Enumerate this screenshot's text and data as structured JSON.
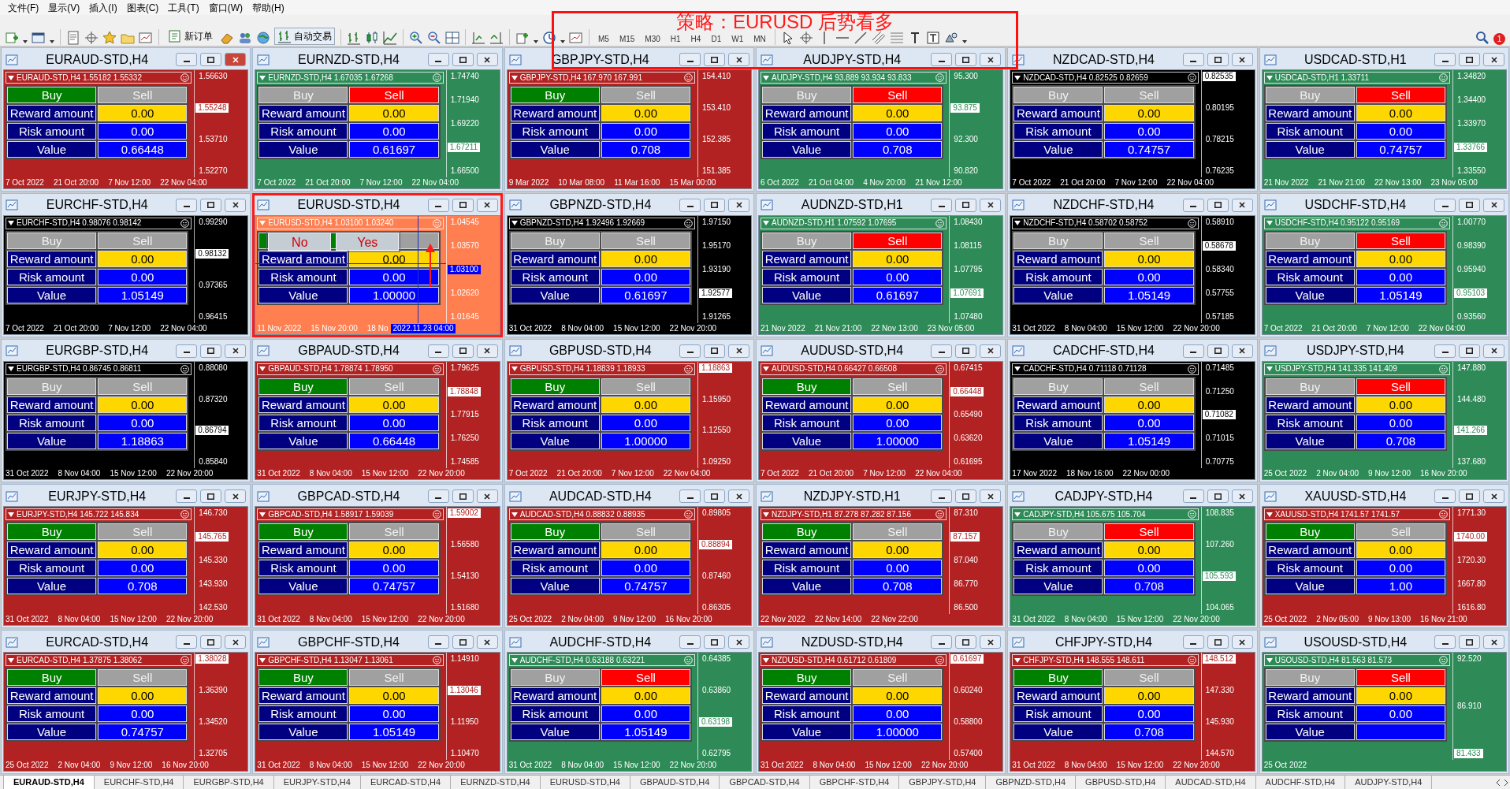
{
  "menu": [
    "文件(F)",
    "显示(V)",
    "插入(I)",
    "图表(C)",
    "工具(T)",
    "窗口(W)",
    "帮助(H)"
  ],
  "toolbar": {
    "new_order": "新订单",
    "auto_trading": "自动交易",
    "timeframes": [
      "M5",
      "M15",
      "M30",
      "H1",
      "H4",
      "D1",
      "W1",
      "MN"
    ],
    "notifications": "1"
  },
  "banner": {
    "text": "策略：EURUSD 后势看多"
  },
  "windows": [
    {
      "title": "EURAUD-STD,H4",
      "active": true,
      "color": "#b22222",
      "header": "EURAUD-STD,H4  1.55182 1.55332",
      "buy": {
        "label": "Buy",
        "selected": true
      },
      "sell": {
        "label": "Sell",
        "selected": false
      },
      "fields": [
        {
          "kind": "reward",
          "label": "Reward amount",
          "value": "0.00"
        },
        {
          "kind": "risk",
          "label": "Risk amount",
          "value": "0.00"
        },
        {
          "kind": "value",
          "label": "Value",
          "value": "0.66448"
        }
      ],
      "axis": [
        {
          "kind": "tick",
          "text": "1.56630"
        },
        {
          "kind": "tag",
          "text": "1.55248"
        },
        {
          "kind": "tick",
          "text": "1.53710"
        },
        {
          "kind": "tick",
          "text": "1.52270"
        }
      ],
      "dates": [
        "7 Oct 2022",
        "21 Oct 20:00",
        "7 Nov 12:00",
        "22 Nov 04:00"
      ]
    },
    {
      "title": "EURNZD-STD,H4",
      "active": false,
      "color": "#2e8b57",
      "header": "EURNZD-STD,H4  1.67035 1.67268",
      "buy": {
        "label": "Buy",
        "selected": false
      },
      "sell": {
        "label": "Sell",
        "selected": true
      },
      "fields": [
        {
          "kind": "reward",
          "label": "Reward amount",
          "value": "0.00"
        },
        {
          "kind": "risk",
          "label": "Risk amount",
          "value": "0.00"
        },
        {
          "kind": "value",
          "label": "Value",
          "value": "0.61697"
        }
      ],
      "axis": [
        {
          "kind": "tick",
          "text": "1.74740"
        },
        {
          "kind": "tick",
          "text": "1.71940"
        },
        {
          "kind": "tick",
          "text": "1.69220"
        },
        {
          "kind": "tag",
          "text": "1.67211"
        },
        {
          "kind": "tick",
          "text": "1.66500"
        }
      ],
      "dates": [
        "7 Oct 2022",
        "21 Oct 20:00",
        "7 Nov 12:00",
        "22 Nov 04:00"
      ]
    },
    {
      "title": "GBPJPY-STD,H4",
      "active": false,
      "color": "#b22222",
      "header": "GBPJPY-STD,H4  167.970 167.991",
      "buy": {
        "label": "Buy",
        "selected": true
      },
      "sell": {
        "label": "Sell",
        "selected": false
      },
      "fields": [
        {
          "kind": "reward",
          "label": "Reward amount",
          "value": "0.00"
        },
        {
          "kind": "risk",
          "label": "Risk amount",
          "value": "0.00"
        },
        {
          "kind": "value",
          "label": "Value",
          "value": "0.708"
        }
      ],
      "axis": [
        {
          "kind": "tick",
          "text": "154.410"
        },
        {
          "kind": "tick",
          "text": "153.410"
        },
        {
          "kind": "tick",
          "text": "152.385"
        },
        {
          "kind": "tick",
          "text": "151.385"
        }
      ],
      "dates": [
        "9 Mar 2022",
        "10 Mar 08:00",
        "11 Mar 16:00",
        "15 Mar 00:00"
      ]
    },
    {
      "title": "AUDJPY-STD,H4",
      "active": false,
      "color": "#2e8b57",
      "header": "AUDJPY-STD,H4  93.889 93.934 93.833",
      "buy": {
        "label": "Buy",
        "selected": false
      },
      "sell": {
        "label": "Sell",
        "selected": true
      },
      "fields": [
        {
          "kind": "reward",
          "label": "Reward amount",
          "value": "0.00"
        },
        {
          "kind": "risk",
          "label": "Risk amount",
          "value": "0.00"
        },
        {
          "kind": "value",
          "label": "Value",
          "value": "0.708"
        }
      ],
      "axis": [
        {
          "kind": "tick",
          "text": "95.300"
        },
        {
          "kind": "tag",
          "text": "93.875"
        },
        {
          "kind": "tick",
          "text": "92.300"
        },
        {
          "kind": "tick",
          "text": "90.820"
        }
      ],
      "dates": [
        "6 Oct 2022",
        "21 Oct 04:00",
        "4 Nov 20:00",
        "21 Nov 12:00"
      ]
    },
    {
      "title": "NZDCAD-STD,H4",
      "active": false,
      "color": "#000000",
      "header": "NZDCAD-STD,H4  0.82525 0.82659",
      "buy": {
        "label": "Buy",
        "selected": false
      },
      "sell": {
        "label": "Sell",
        "selected": false
      },
      "fields": [
        {
          "kind": "reward",
          "label": "Reward amount",
          "value": "0.00"
        },
        {
          "kind": "risk",
          "label": "Risk amount",
          "value": "0.00"
        },
        {
          "kind": "value",
          "label": "Value",
          "value": "0.74757"
        }
      ],
      "axis": [
        {
          "kind": "tag",
          "text": "0.82535"
        },
        {
          "kind": "tick",
          "text": "0.80195"
        },
        {
          "kind": "tick",
          "text": "0.78215"
        },
        {
          "kind": "tick",
          "text": "0.76235"
        }
      ],
      "dates": [
        "7 Oct 2022",
        "21 Oct 20:00",
        "7 Nov 12:00",
        "22 Nov 04:00"
      ]
    },
    {
      "title": "USDCAD-STD,H1",
      "active": false,
      "color": "#2e8b57",
      "header": "USDCAD-STD,H1  1.33711",
      "buy": {
        "label": "Buy",
        "selected": false
      },
      "sell": {
        "label": "Sell",
        "selected": true
      },
      "fields": [
        {
          "kind": "reward",
          "label": "Reward amount",
          "value": "0.00"
        },
        {
          "kind": "risk",
          "label": "Risk amount",
          "value": "0.00"
        },
        {
          "kind": "value",
          "label": "Value",
          "value": "0.74757"
        }
      ],
      "axis": [
        {
          "kind": "tick",
          "text": "1.34820"
        },
        {
          "kind": "tick",
          "text": "1.34400"
        },
        {
          "kind": "tick",
          "text": "1.33970"
        },
        {
          "kind": "tag",
          "text": "1.33766"
        },
        {
          "kind": "tick",
          "text": "1.33550"
        }
      ],
      "dates": [
        "21 Nov 2022",
        "21 Nov 21:00",
        "22 Nov 13:00",
        "23 Nov 05:00"
      ]
    },
    {
      "title": "EURCHF-STD,H4",
      "active": false,
      "color": "#000000",
      "header": "EURCHF-STD,H4  0.98076 0.98142",
      "buy": {
        "label": "Buy",
        "selected": false
      },
      "sell": {
        "label": "Sell",
        "selected": false
      },
      "fields": [
        {
          "kind": "reward",
          "label": "Reward amount",
          "value": "0.00"
        },
        {
          "kind": "risk",
          "label": "Risk amount",
          "value": "0.00"
        },
        {
          "kind": "value",
          "label": "Value",
          "value": "1.05149"
        }
      ],
      "axis": [
        {
          "kind": "tick",
          "text": "0.99290"
        },
        {
          "kind": "tag",
          "text": "0.98132"
        },
        {
          "kind": "tick",
          "text": "0.97365"
        },
        {
          "kind": "tick",
          "text": "0.96415"
        }
      ],
      "dates": [
        "7 Oct 2022",
        "21 Oct 20:00",
        "7 Nov 12:00",
        "22 Nov 04:00"
      ]
    },
    {
      "title": "EURUSD-STD,H4",
      "active": false,
      "highlighted": true,
      "crosshair": true,
      "color": "#ff7f50",
      "header": "EURUSD-STD,H4  1.03100 1.03240",
      "buy": {
        "selected": true
      },
      "sell": {
        "selected": false
      },
      "dialog": [
        "No",
        "Yes"
      ],
      "fields": [
        {
          "kind": "reward",
          "label": "Reward amount",
          "value": "0.00"
        },
        {
          "kind": "risk",
          "label": "Risk amount",
          "value": "0.00"
        },
        {
          "kind": "value",
          "label": "Value",
          "value": "1.00000"
        }
      ],
      "axis": [
        {
          "kind": "tick",
          "text": "1.04545"
        },
        {
          "kind": "tick",
          "text": "1.03570"
        },
        {
          "kind": "cursor",
          "text": "1.03100"
        },
        {
          "kind": "tick",
          "text": "1.02620"
        },
        {
          "kind": "tick",
          "text": "1.01645"
        }
      ],
      "dates": [
        "11 Nov 2022",
        "15 Nov 20:00",
        "18 No"
      ],
      "date_cursor": "2022.11.23 04:00"
    },
    {
      "title": "GBPNZD-STD,H4",
      "active": false,
      "color": "#000000",
      "header": "GBPNZD-STD,H4  1.92496 1.92669",
      "buy": {
        "label": "Buy",
        "selected": false
      },
      "sell": {
        "label": "Sell",
        "selected": false
      },
      "fields": [
        {
          "kind": "reward",
          "label": "Reward amount",
          "value": "0.00"
        },
        {
          "kind": "risk",
          "label": "Risk amount",
          "value": "0.00"
        },
        {
          "kind": "value",
          "label": "Value",
          "value": "0.61697"
        }
      ],
      "axis": [
        {
          "kind": "tick",
          "text": "1.97150"
        },
        {
          "kind": "tick",
          "text": "1.95170"
        },
        {
          "kind": "tick",
          "text": "1.93190"
        },
        {
          "kind": "tag",
          "text": "1.92577"
        },
        {
          "kind": "tick",
          "text": "1.91265"
        }
      ],
      "dates": [
        "31 Oct 2022",
        "8 Nov 04:00",
        "15 Nov 12:00",
        "22 Nov 20:00"
      ]
    },
    {
      "title": "AUDNZD-STD,H1",
      "active": false,
      "color": "#2e8b57",
      "header": "AUDNZD-STD,H1  1.07592 1.07695",
      "buy": {
        "label": "Buy",
        "selected": false
      },
      "sell": {
        "label": "Sell",
        "selected": true
      },
      "fields": [
        {
          "kind": "reward",
          "label": "Reward amount",
          "value": "0.00"
        },
        {
          "kind": "risk",
          "label": "Risk amount",
          "value": "0.00"
        },
        {
          "kind": "value",
          "label": "Value",
          "value": "0.61697"
        }
      ],
      "axis": [
        {
          "kind": "tick",
          "text": "1.08430"
        },
        {
          "kind": "tick",
          "text": "1.08115"
        },
        {
          "kind": "tick",
          "text": "1.07795"
        },
        {
          "kind": "tag",
          "text": "1.07691"
        },
        {
          "kind": "tick",
          "text": "1.07480"
        }
      ],
      "dates": [
        "21 Nov 2022",
        "21 Nov 21:00",
        "22 Nov 13:00",
        "23 Nov 05:00"
      ]
    },
    {
      "title": "NZDCHF-STD,H4",
      "active": false,
      "color": "#000000",
      "header": "NZDCHF-STD,H4  0.58702 0.58752",
      "buy": {
        "label": "Buy",
        "selected": false
      },
      "sell": {
        "label": "Sell",
        "selected": false
      },
      "fields": [
        {
          "kind": "reward",
          "label": "Reward amount",
          "value": "0.00"
        },
        {
          "kind": "risk",
          "label": "Risk amount",
          "value": "0.00"
        },
        {
          "kind": "value",
          "label": "Value",
          "value": "1.05149"
        }
      ],
      "axis": [
        {
          "kind": "tick",
          "text": "0.58910"
        },
        {
          "kind": "tag",
          "text": "0.58678"
        },
        {
          "kind": "tick",
          "text": "0.58340"
        },
        {
          "kind": "tick",
          "text": "0.57755"
        },
        {
          "kind": "tick",
          "text": "0.57185"
        }
      ],
      "dates": [
        "31 Oct 2022",
        "8 Nov 04:00",
        "15 Nov 12:00",
        "22 Nov 20:00"
      ]
    },
    {
      "title": "USDCHF-STD,H4",
      "active": false,
      "color": "#2e8b57",
      "header": "USDCHF-STD,H4  0.95122 0.95169",
      "buy": {
        "label": "Buy",
        "selected": false
      },
      "sell": {
        "label": "Sell",
        "selected": true
      },
      "fields": [
        {
          "kind": "reward",
          "label": "Reward amount",
          "value": "0.00"
        },
        {
          "kind": "risk",
          "label": "Risk amount",
          "value": "0.00"
        },
        {
          "kind": "value",
          "label": "Value",
          "value": "1.05149"
        }
      ],
      "axis": [
        {
          "kind": "tick",
          "text": "1.00770"
        },
        {
          "kind": "tick",
          "text": "0.98390"
        },
        {
          "kind": "tick",
          "text": "0.95940"
        },
        {
          "kind": "tag",
          "text": "0.95103"
        },
        {
          "kind": "tick",
          "text": "0.93560"
        }
      ],
      "dates": [
        "7 Oct 2022",
        "21 Oct 20:00",
        "7 Nov 12:00",
        "22 Nov 04:00"
      ]
    },
    {
      "title": "EURGBP-STD,H4",
      "active": false,
      "color": "#000000",
      "header": "EURGBP-STD,H4  0.86745 0.86811",
      "buy": {
        "label": "Buy",
        "selected": false
      },
      "sell": {
        "label": "Sell",
        "selected": false
      },
      "fields": [
        {
          "kind": "reward",
          "label": "Reward amount",
          "value": "0.00"
        },
        {
          "kind": "risk",
          "label": "Risk amount",
          "value": "0.00"
        },
        {
          "kind": "value",
          "label": "Value",
          "value": "1.18863"
        }
      ],
      "axis": [
        {
          "kind": "tick",
          "text": "0.88080"
        },
        {
          "kind": "tick",
          "text": "0.87320"
        },
        {
          "kind": "tag",
          "text": "0.86794"
        },
        {
          "kind": "tick",
          "text": "0.85840"
        }
      ],
      "dates": [
        "31 Oct 2022",
        "8 Nov 04:00",
        "15 Nov 12:00",
        "22 Nov 20:00"
      ]
    },
    {
      "title": "GBPAUD-STD,H4",
      "active": false,
      "color": "#b22222",
      "header": "GBPAUD-STD,H4  1.78874 1.78950",
      "buy": {
        "label": "Buy",
        "selected": true
      },
      "sell": {
        "label": "Sell",
        "selected": false
      },
      "fields": [
        {
          "kind": "reward",
          "label": "Reward amount",
          "value": "0.00"
        },
        {
          "kind": "risk",
          "label": "Risk amount",
          "value": "0.00"
        },
        {
          "kind": "value",
          "label": "Value",
          "value": "0.66448"
        }
      ],
      "axis": [
        {
          "kind": "tick",
          "text": "1.79625"
        },
        {
          "kind": "tag",
          "text": "1.78848"
        },
        {
          "kind": "tick",
          "text": "1.77915"
        },
        {
          "kind": "tick",
          "text": "1.76250"
        },
        {
          "kind": "tick",
          "text": "1.74585"
        }
      ],
      "dates": [
        "31 Oct 2022",
        "8 Nov 04:00",
        "15 Nov 12:00",
        "22 Nov 20:00"
      ]
    },
    {
      "title": "GBPUSD-STD,H4",
      "active": false,
      "color": "#b22222",
      "header": "GBPUSD-STD,H4  1.18839 1.18933",
      "buy": {
        "label": "Buy",
        "selected": true
      },
      "sell": {
        "label": "Sell",
        "selected": false
      },
      "fields": [
        {
          "kind": "reward",
          "label": "Reward amount",
          "value": "0.00"
        },
        {
          "kind": "risk",
          "label": "Risk amount",
          "value": "0.00"
        },
        {
          "kind": "value",
          "label": "Value",
          "value": "1.00000"
        }
      ],
      "axis": [
        {
          "kind": "tag",
          "text": "1.18863"
        },
        {
          "kind": "tick",
          "text": "1.15950"
        },
        {
          "kind": "tick",
          "text": "1.12550"
        },
        {
          "kind": "tick",
          "text": "1.09250"
        }
      ],
      "dates": [
        "7 Oct 2022",
        "21 Oct 20:00",
        "7 Nov 12:00",
        "22 Nov 04:00"
      ]
    },
    {
      "title": "AUDUSD-STD,H4",
      "active": false,
      "color": "#b22222",
      "header": "AUDUSD-STD,H4  0.66427 0.66508",
      "buy": {
        "label": "Buy",
        "selected": true
      },
      "sell": {
        "label": "Sell",
        "selected": false
      },
      "fields": [
        {
          "kind": "reward",
          "label": "Reward amount",
          "value": "0.00"
        },
        {
          "kind": "risk",
          "label": "Risk amount",
          "value": "0.00"
        },
        {
          "kind": "value",
          "label": "Value",
          "value": "1.00000"
        }
      ],
      "axis": [
        {
          "kind": "tick",
          "text": "0.67415"
        },
        {
          "kind": "tag",
          "text": "0.66448"
        },
        {
          "kind": "tick",
          "text": "0.65490"
        },
        {
          "kind": "tick",
          "text": "0.63620"
        },
        {
          "kind": "tick",
          "text": "0.61695"
        }
      ],
      "dates": [
        "7 Oct 2022",
        "21 Oct 20:00",
        "7 Nov 12:00",
        "22 Nov 04:00"
      ]
    },
    {
      "title": "CADCHF-STD,H4",
      "active": false,
      "color": "#000000",
      "header": "CADCHF-STD,H4  0.71118 0.71128",
      "buy": {
        "label": "Buy",
        "selected": false
      },
      "sell": {
        "label": "Sell",
        "selected": false
      },
      "fields": [
        {
          "kind": "reward",
          "label": "Reward amount",
          "value": "0.00"
        },
        {
          "kind": "risk",
          "label": "Risk amount",
          "value": "0.00"
        },
        {
          "kind": "value",
          "label": "Value",
          "value": "1.05149"
        }
      ],
      "axis": [
        {
          "kind": "tick",
          "text": "0.71485"
        },
        {
          "kind": "tick",
          "text": "0.71250"
        },
        {
          "kind": "tag",
          "text": "0.71082"
        },
        {
          "kind": "tick",
          "text": "0.71015"
        },
        {
          "kind": "tick",
          "text": "0.70775"
        }
      ],
      "dates": [
        "17 Nov 2022",
        "18 Nov 16:00",
        "22 Nov 00:00"
      ]
    },
    {
      "title": "USDJPY-STD,H4",
      "active": false,
      "color": "#2e8b57",
      "header": "USDJPY-STD,H4  141.335 141.409",
      "buy": {
        "label": "Buy",
        "selected": false
      },
      "sell": {
        "label": "Sell",
        "selected": true
      },
      "fields": [
        {
          "kind": "reward",
          "label": "Reward amount",
          "value": "0.00"
        },
        {
          "kind": "risk",
          "label": "Risk amount",
          "value": "0.00"
        },
        {
          "kind": "value",
          "label": "Value",
          "value": "0.708"
        }
      ],
      "axis": [
        {
          "kind": "tick",
          "text": "147.880"
        },
        {
          "kind": "tick",
          "text": "144.480"
        },
        {
          "kind": "tag",
          "text": "141.266"
        },
        {
          "kind": "tick",
          "text": "137.680"
        }
      ],
      "dates": [
        "25 Oct 2022",
        "2 Nov 04:00",
        "9 Nov 12:00",
        "16 Nov 20:00"
      ]
    },
    {
      "title": "EURJPY-STD,H4",
      "active": false,
      "color": "#b22222",
      "header": "EURJPY-STD,H4  145.722 145.834",
      "buy": {
        "label": "Buy",
        "selected": true
      },
      "sell": {
        "label": "Sell",
        "selected": false
      },
      "fields": [
        {
          "kind": "reward",
          "label": "Reward amount",
          "value": "0.00"
        },
        {
          "kind": "risk",
          "label": "Risk amount",
          "value": "0.00"
        },
        {
          "kind": "value",
          "label": "Value",
          "value": "0.708"
        }
      ],
      "axis": [
        {
          "kind": "tick",
          "text": "146.730"
        },
        {
          "kind": "tag",
          "text": "145.765"
        },
        {
          "kind": "tick",
          "text": "145.330"
        },
        {
          "kind": "tick",
          "text": "143.930"
        },
        {
          "kind": "tick",
          "text": "142.530"
        }
      ],
      "dates": [
        "31 Oct 2022",
        "8 Nov 04:00",
        "15 Nov 12:00",
        "22 Nov 20:00"
      ]
    },
    {
      "title": "GBPCAD-STD,H4",
      "active": false,
      "color": "#b22222",
      "header": "GBPCAD-STD,H4  1.58917 1.59039",
      "buy": {
        "label": "Buy",
        "selected": true
      },
      "sell": {
        "label": "Sell",
        "selected": false
      },
      "fields": [
        {
          "kind": "reward",
          "label": "Reward amount",
          "value": "0.00"
        },
        {
          "kind": "risk",
          "label": "Risk amount",
          "value": "0.00"
        },
        {
          "kind": "value",
          "label": "Value",
          "value": "0.74757"
        }
      ],
      "axis": [
        {
          "kind": "tag",
          "text": "1.59002"
        },
        {
          "kind": "tick",
          "text": "1.56580"
        },
        {
          "kind": "tick",
          "text": "1.54130"
        },
        {
          "kind": "tick",
          "text": "1.51680"
        }
      ],
      "dates": [
        "31 Oct 2022",
        "8 Nov 04:00",
        "15 Nov 12:00",
        "22 Nov 20:00"
      ]
    },
    {
      "title": "AUDCAD-STD,H4",
      "active": false,
      "color": "#b22222",
      "header": "AUDCAD-STD,H4  0.88832 0.88935",
      "buy": {
        "label": "Buy",
        "selected": true
      },
      "sell": {
        "label": "Sell",
        "selected": false
      },
      "fields": [
        {
          "kind": "reward",
          "label": "Reward amount",
          "value": "0.00"
        },
        {
          "kind": "risk",
          "label": "Risk amount",
          "value": "0.00"
        },
        {
          "kind": "value",
          "label": "Value",
          "value": "0.74757"
        }
      ],
      "axis": [
        {
          "kind": "tick",
          "text": "0.89805"
        },
        {
          "kind": "tag",
          "text": "0.88894"
        },
        {
          "kind": "tick",
          "text": "0.87460"
        },
        {
          "kind": "tick",
          "text": "0.86305"
        }
      ],
      "dates": [
        "25 Oct 2022",
        "2 Nov 04:00",
        "9 Nov 12:00",
        "16 Nov 20:00"
      ]
    },
    {
      "title": "NZDJPY-STD,H1",
      "active": false,
      "color": "#b22222",
      "header": "NZDJPY-STD,H1  87.278 87.282 87.156",
      "buy": {
        "label": "Buy",
        "selected": true
      },
      "sell": {
        "label": "Sell",
        "selected": false
      },
      "fields": [
        {
          "kind": "reward",
          "label": "Reward amount",
          "value": "0.00"
        },
        {
          "kind": "risk",
          "label": "Risk amount",
          "value": "0.00"
        },
        {
          "kind": "value",
          "label": "Value",
          "value": "0.708"
        }
      ],
      "axis": [
        {
          "kind": "tick",
          "text": "87.310"
        },
        {
          "kind": "tag",
          "text": "87.157"
        },
        {
          "kind": "tick",
          "text": "87.040"
        },
        {
          "kind": "tick",
          "text": "86.770"
        },
        {
          "kind": "tick",
          "text": "86.500"
        }
      ],
      "dates": [
        "22 Nov 2022",
        "22 Nov 14:00",
        "22 Nov 22:00"
      ]
    },
    {
      "title": "CADJPY-STD,H4",
      "active": false,
      "color": "#2e8b57",
      "header": "CADJPY-STD,H4  105.675 105.704",
      "buy": {
        "label": "Buy",
        "selected": false
      },
      "sell": {
        "label": "Sell",
        "selected": true
      },
      "fields": [
        {
          "kind": "reward",
          "label": "Reward amount",
          "value": "0.00"
        },
        {
          "kind": "risk",
          "label": "Risk amount",
          "value": "0.00"
        },
        {
          "kind": "value",
          "label": "Value",
          "value": "0.708"
        }
      ],
      "axis": [
        {
          "kind": "tick",
          "text": "108.835"
        },
        {
          "kind": "tick",
          "text": "107.260"
        },
        {
          "kind": "tag",
          "text": "105.593"
        },
        {
          "kind": "tick",
          "text": "104.065"
        }
      ],
      "dates": [
        "31 Oct 2022",
        "8 Nov 04:00",
        "15 Nov 12:00",
        "22 Nov 20:00"
      ]
    },
    {
      "title": "XAUUSD-STD,H4",
      "active": false,
      "color": "#b22222",
      "header": "XAUUSD-STD,H4  1741.57 1741.57",
      "buy": {
        "label": "Buy",
        "selected": true
      },
      "sell": {
        "label": "Sell",
        "selected": false
      },
      "fields": [
        {
          "kind": "reward",
          "label": "Reward amount",
          "value": "0.00"
        },
        {
          "kind": "risk",
          "label": "Risk amount",
          "value": "0.00"
        },
        {
          "kind": "value",
          "label": "Value",
          "value": "1.00"
        }
      ],
      "axis": [
        {
          "kind": "tick",
          "text": "1771.30"
        },
        {
          "kind": "tag",
          "text": "1740.00"
        },
        {
          "kind": "tick",
          "text": "1720.30"
        },
        {
          "kind": "tick",
          "text": "1667.80"
        },
        {
          "kind": "tick",
          "text": "1616.80"
        }
      ],
      "dates": [
        "25 Oct 2022",
        "2 Nov 05:00",
        "9 Nov 13:00",
        "16 Nov 21:00"
      ]
    },
    {
      "title": "EURCAD-STD,H4",
      "active": false,
      "color": "#b22222",
      "header": "EURCAD-STD,H4  1.37875 1.38062",
      "buy": {
        "label": "Buy",
        "selected": true
      },
      "sell": {
        "label": "Sell",
        "selected": false
      },
      "fields": [
        {
          "kind": "reward",
          "label": "Reward amount",
          "value": "0.00"
        },
        {
          "kind": "risk",
          "label": "Risk amount",
          "value": "0.00"
        },
        {
          "kind": "value",
          "label": "Value",
          "value": "0.74757"
        }
      ],
      "axis": [
        {
          "kind": "tag",
          "text": "1.38028"
        },
        {
          "kind": "tick",
          "text": "1.36390"
        },
        {
          "kind": "tick",
          "text": "1.34520"
        },
        {
          "kind": "tick",
          "text": "1.32705"
        }
      ],
      "dates": [
        "25 Oct 2022",
        "2 Nov 04:00",
        "9 Nov 12:00",
        "16 Nov 20:00"
      ]
    },
    {
      "title": "GBPCHF-STD,H4",
      "active": false,
      "color": "#b22222",
      "header": "GBPCHF-STD,H4  1.13047 1.13061",
      "buy": {
        "label": "Buy",
        "selected": true
      },
      "sell": {
        "label": "Sell",
        "selected": false
      },
      "fields": [
        {
          "kind": "reward",
          "label": "Reward amount",
          "value": "0.00"
        },
        {
          "kind": "risk",
          "label": "Risk amount",
          "value": "0.00"
        },
        {
          "kind": "value",
          "label": "Value",
          "value": "1.05149"
        }
      ],
      "axis": [
        {
          "kind": "tick",
          "text": "1.14910"
        },
        {
          "kind": "tag",
          "text": "1.13046"
        },
        {
          "kind": "tick",
          "text": "1.11950"
        },
        {
          "kind": "tick",
          "text": "1.10470"
        }
      ],
      "dates": [
        "31 Oct 2022",
        "8 Nov 04:00",
        "15 Nov 12:00",
        "22 Nov 20:00"
      ]
    },
    {
      "title": "AUDCHF-STD,H4",
      "active": false,
      "color": "#2e8b57",
      "header": "AUDCHF-STD,H4  0.63188 0.63221",
      "buy": {
        "label": "Buy",
        "selected": false
      },
      "sell": {
        "label": "Sell",
        "selected": true
      },
      "fields": [
        {
          "kind": "reward",
          "label": "Reward amount",
          "value": "0.00"
        },
        {
          "kind": "risk",
          "label": "Risk amount",
          "value": "0.00"
        },
        {
          "kind": "value",
          "label": "Value",
          "value": "1.05149"
        }
      ],
      "axis": [
        {
          "kind": "tick",
          "text": "0.64385"
        },
        {
          "kind": "tick",
          "text": "0.63860"
        },
        {
          "kind": "tag",
          "text": "0.63198"
        },
        {
          "kind": "tick",
          "text": "0.62795"
        }
      ],
      "dates": [
        "31 Oct 2022",
        "8 Nov 04:00",
        "15 Nov 12:00",
        "22 Nov 20:00"
      ]
    },
    {
      "title": "NZDUSD-STD,H4",
      "active": false,
      "color": "#b22222",
      "header": "NZDUSD-STD,H4  0.61712 0.61809",
      "buy": {
        "label": "Buy",
        "selected": true
      },
      "sell": {
        "label": "Sell",
        "selected": false
      },
      "fields": [
        {
          "kind": "reward",
          "label": "Reward amount",
          "value": "0.00"
        },
        {
          "kind": "risk",
          "label": "Risk amount",
          "value": "0.00"
        },
        {
          "kind": "value",
          "label": "Value",
          "value": "1.00000"
        }
      ],
      "axis": [
        {
          "kind": "tag",
          "text": "0.61697"
        },
        {
          "kind": "tick",
          "text": "0.60240"
        },
        {
          "kind": "tick",
          "text": "0.58800"
        },
        {
          "kind": "tick",
          "text": "0.57400"
        }
      ],
      "dates": [
        "31 Oct 2022",
        "8 Nov 04:00",
        "15 Nov 12:00",
        "22 Nov 20:00"
      ]
    },
    {
      "title": "CHFJPY-STD,H4",
      "active": false,
      "color": "#b22222",
      "header": "CHFJPY-STD,H4  148.555 148.611",
      "buy": {
        "label": "Buy",
        "selected": true
      },
      "sell": {
        "label": "Sell",
        "selected": false
      },
      "fields": [
        {
          "kind": "reward",
          "label": "Reward amount",
          "value": "0.00"
        },
        {
          "kind": "risk",
          "label": "Risk amount",
          "value": "0.00"
        },
        {
          "kind": "value",
          "label": "Value",
          "value": "0.708"
        }
      ],
      "axis": [
        {
          "kind": "tag",
          "text": "148.512"
        },
        {
          "kind": "tick",
          "text": "147.330"
        },
        {
          "kind": "tick",
          "text": "145.930"
        },
        {
          "kind": "tick",
          "text": "144.570"
        }
      ],
      "dates": [
        "31 Oct 2022",
        "8 Nov 04:00",
        "15 Nov 12:00",
        "22 Nov 20:00"
      ]
    },
    {
      "title": "USOUSD-STD,H4",
      "active": false,
      "color": "#2e8b57",
      "header": "USOUSD-STD,H4  81.563 81.573",
      "buy": {
        "label": "Buy",
        "selected": false
      },
      "sell": {
        "label": "Sell",
        "selected": true
      },
      "fields": [
        {
          "kind": "reward",
          "label": "Reward amount",
          "value": "0.00"
        },
        {
          "kind": "risk",
          "label": "Risk amount",
          "value": "0.00"
        },
        {
          "kind": "value",
          "label": "Value"
        }
      ],
      "axis": [
        {
          "kind": "tick",
          "text": "92.520"
        },
        {
          "kind": "tick",
          "text": "86.910"
        },
        {
          "kind": "tag",
          "text": "81.433"
        }
      ],
      "dates": [
        "25 Oct 2022"
      ]
    }
  ],
  "tabs": [
    {
      "label": "EURAUD-STD,H4",
      "selected": true
    },
    {
      "label": "EURCHF-STD,H4",
      "selected": false
    },
    {
      "label": "EURGBP-STD,H4",
      "selected": false
    },
    {
      "label": "EURJPY-STD,H4",
      "selected": false
    },
    {
      "label": "EURCAD-STD,H4",
      "selected": false
    },
    {
      "label": "EURNZD-STD,H4",
      "selected": false
    },
    {
      "label": "EURUSD-STD,H4",
      "selected": false
    },
    {
      "label": "GBPAUD-STD,H4",
      "selected": false
    },
    {
      "label": "GBPCAD-STD,H4",
      "selected": false
    },
    {
      "label": "GBPCHF-STD,H4",
      "selected": false
    },
    {
      "label": "GBPJPY-STD,H4",
      "selected": false
    },
    {
      "label": "GBPNZD-STD,H4",
      "selected": false
    },
    {
      "label": "GBPUSD-STD,H4",
      "selected": false
    },
    {
      "label": "AUDCAD-STD,H4",
      "selected": false
    },
    {
      "label": "AUDCHF-STD,H4",
      "selected": false
    },
    {
      "label": "AUDJPY-STD,H4",
      "selected": false
    }
  ]
}
